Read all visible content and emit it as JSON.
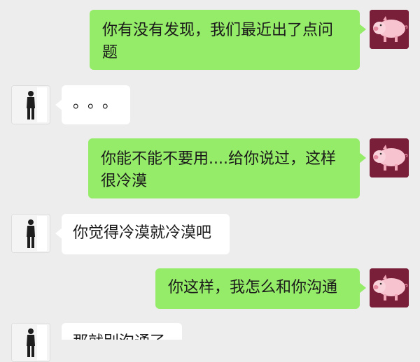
{
  "messages": [
    {
      "side": "out",
      "text": "你有没有发现，我们最近出了点问题",
      "avatar": "pig-avatar"
    },
    {
      "side": "in",
      "text": "。。。",
      "avatar": "person-avatar"
    },
    {
      "side": "out",
      "text": "你能不能不要用....给你说过，这样很冷漠",
      "avatar": "pig-avatar"
    },
    {
      "side": "in",
      "text": "你觉得冷漠就冷漠吧",
      "avatar": "person-avatar"
    },
    {
      "side": "out",
      "text": "你这样，我怎么和你沟通",
      "avatar": "pig-avatar"
    },
    {
      "side": "in",
      "text": "那就别沟通了",
      "avatar": "person-avatar"
    }
  ],
  "colors": {
    "background": "#ededed",
    "outgoing_bubble": "#95ec69",
    "incoming_bubble": "#ffffff",
    "pig_avatar_bg": "#7a1f3a"
  }
}
